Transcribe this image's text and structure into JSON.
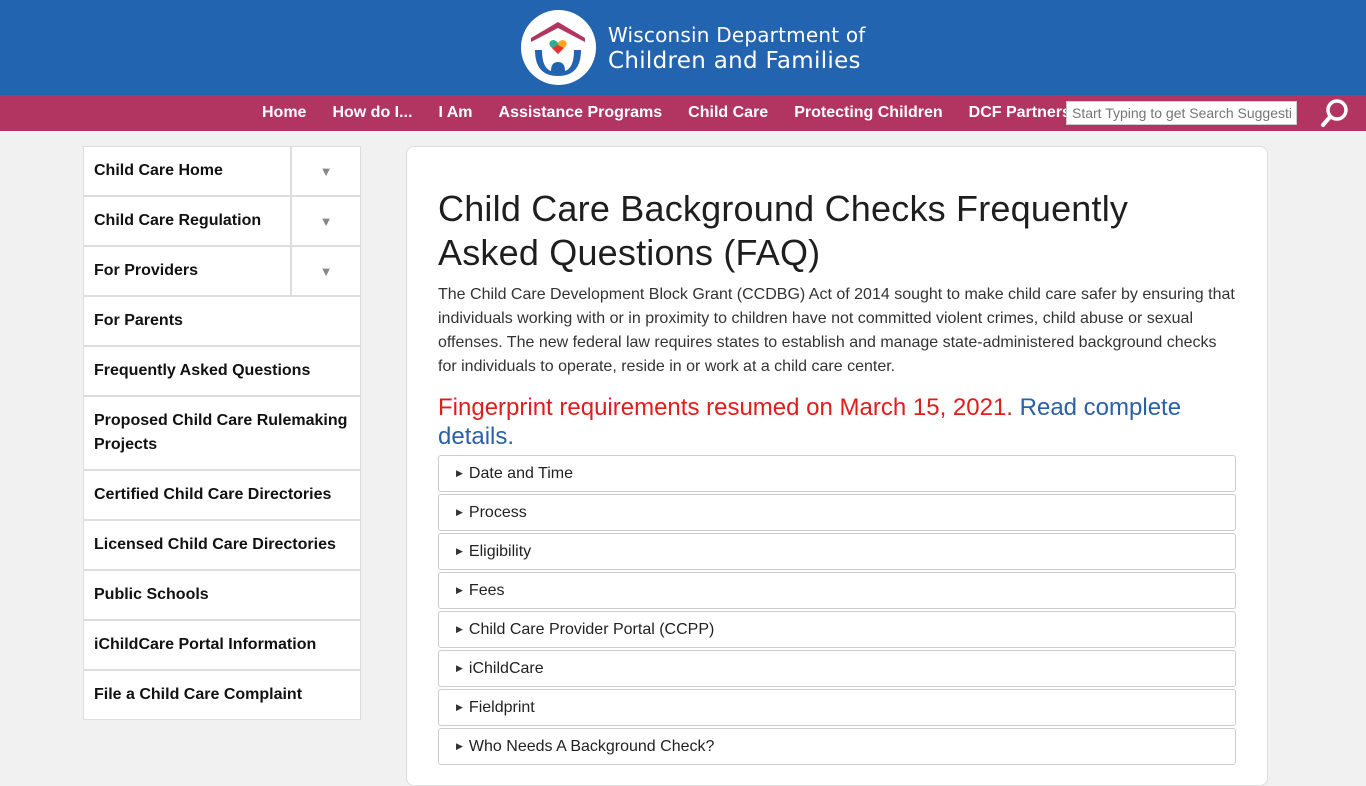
{
  "header": {
    "org_line1": "Wisconsin Department of",
    "org_line2": "Children and Families",
    "logo_colors": {
      "roof": "#b13560",
      "arms": "#2364b0",
      "heart_teal": "#3aa88f",
      "heart_orange": "#f5a623",
      "heart_red": "#e3342f"
    }
  },
  "nav": {
    "items": [
      {
        "label": "Home"
      },
      {
        "label": "How do I..."
      },
      {
        "label": "I Am"
      },
      {
        "label": "Assistance Programs"
      },
      {
        "label": "Child Care"
      },
      {
        "label": "Protecting Children"
      },
      {
        "label": "DCF Partners"
      }
    ],
    "search": {
      "placeholder": "Start Typing to get Search Suggestions",
      "value": "",
      "icon": "search-icon"
    }
  },
  "sidebar": {
    "items": [
      {
        "label": "Child Care Home",
        "expandable": true
      },
      {
        "label": "Child Care Regulation",
        "expandable": true
      },
      {
        "label": "For Providers",
        "expandable": true
      },
      {
        "label": "For Parents",
        "expandable": false
      },
      {
        "label": "Frequently Asked Questions",
        "expandable": false
      },
      {
        "label": "Proposed Child Care Rulemaking Projects",
        "expandable": false
      },
      {
        "label": "Certified Child Care Directories",
        "expandable": false
      },
      {
        "label": "Licensed Child Care Directories",
        "expandable": false
      },
      {
        "label": "Public Schools",
        "expandable": false
      },
      {
        "label": "iChildCare Portal Information",
        "expandable": false
      },
      {
        "label": "File a Child Care Complaint",
        "expandable": false
      }
    ],
    "toggle_glyph": "▼"
  },
  "main": {
    "title": "Child Care Background Checks Frequently Asked Questions (FAQ)",
    "intro": "The Child Care Development Block Grant (CCDBG) Act of 2014 sought to make child care safer by ensuring that individuals working with or in proximity to children have not committed violent crimes, child abuse or sexual offenses. The new federal law requires states to establish and manage state-administered background checks for individuals to operate, reside in or work at a child care center.",
    "notice_text": "Fingerprint requirements resumed on March 15, 2021.",
    "notice_link": "Read complete details.",
    "notice_color": "#e01c1c",
    "link_color": "#2b5fa8",
    "accordion": [
      {
        "label": "Date and Time"
      },
      {
        "label": "Process"
      },
      {
        "label": "Eligibility"
      },
      {
        "label": "Fees"
      },
      {
        "label": "Child Care Provider Portal (CCPP)"
      },
      {
        "label": "iChildCare"
      },
      {
        "label": "Fieldprint"
      },
      {
        "label": "Who Needs A Background Check?"
      }
    ],
    "arrow_glyph": "▶"
  }
}
